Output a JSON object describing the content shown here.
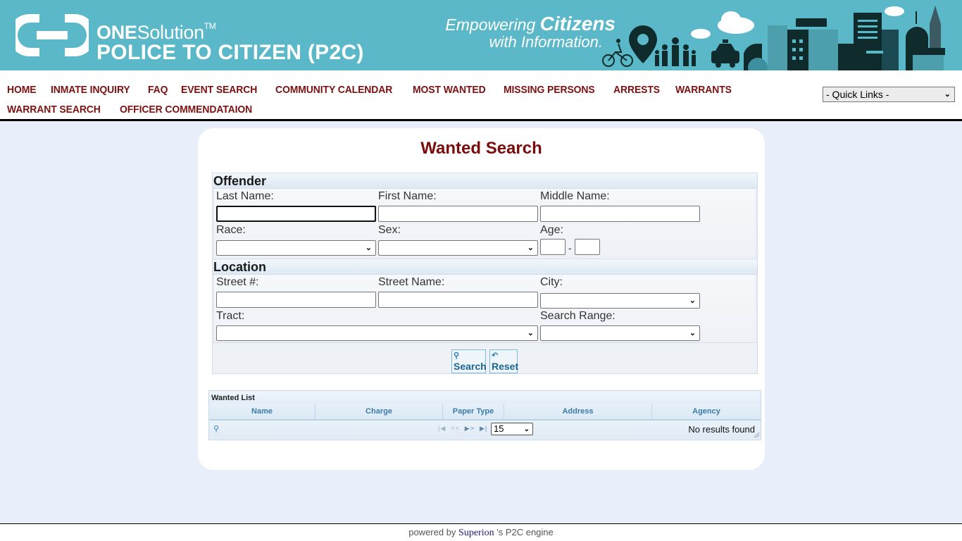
{
  "header": {
    "brand_one_bold": "ONE",
    "brand_one_rest": "Solution",
    "brand_tm": "TM",
    "brand_product": "POLICE TO CITIZEN (P2C)",
    "tagline_line1_prefix": "Empowering ",
    "tagline_line1_bold": "Citizens",
    "tagline_line2": "with Information.",
    "banner_color": "#5bb8c8"
  },
  "nav": {
    "items": [
      {
        "label": "HOME"
      },
      {
        "label": "INMATE INQUIRY"
      },
      {
        "label": "FAQ"
      },
      {
        "label": "EVENT SEARCH"
      },
      {
        "label": "COMMUNITY CALENDAR"
      },
      {
        "label": "MOST WANTED"
      },
      {
        "label": "MISSING PERSONS"
      },
      {
        "label": "ARRESTS"
      },
      {
        "label": "WARRANTS"
      },
      {
        "label": "WARRANT SEARCH"
      },
      {
        "label": "OFFICER COMMENDATAION"
      }
    ],
    "quick_links": "- Quick Links -",
    "link_color": "#7b1212"
  },
  "form": {
    "title": "Wanted Search",
    "offender": {
      "heading": "Offender",
      "last_name_label": "Last Name:",
      "last_name_value": "",
      "first_name_label": "First Name:",
      "first_name_value": "",
      "middle_name_label": "Middle Name:",
      "middle_name_value": "",
      "race_label": "Race:",
      "race_value": "",
      "sex_label": "Sex:",
      "sex_value": "",
      "age_label": "Age:",
      "age_from": "",
      "age_separator": "-",
      "age_to": ""
    },
    "location": {
      "heading": "Location",
      "street_num_label": "Street #:",
      "street_num_value": "",
      "street_name_label": "Street Name:",
      "street_name_value": "",
      "city_label": "City:",
      "city_value": "",
      "tract_label": "Tract:",
      "tract_value": "",
      "search_range_label": "Search Range:",
      "search_range_value": ""
    },
    "buttons": {
      "search": "Search",
      "reset": "Reset"
    }
  },
  "grid": {
    "caption": "Wanted List",
    "columns": [
      "Name",
      "Charge",
      "Paper Type",
      "Address",
      "Agency"
    ],
    "rows": [],
    "page_size": "15",
    "status": "No results found"
  },
  "footer": {
    "prefix": "powered by ",
    "brand": "Superion",
    "suffix": " 's P2C engine"
  }
}
